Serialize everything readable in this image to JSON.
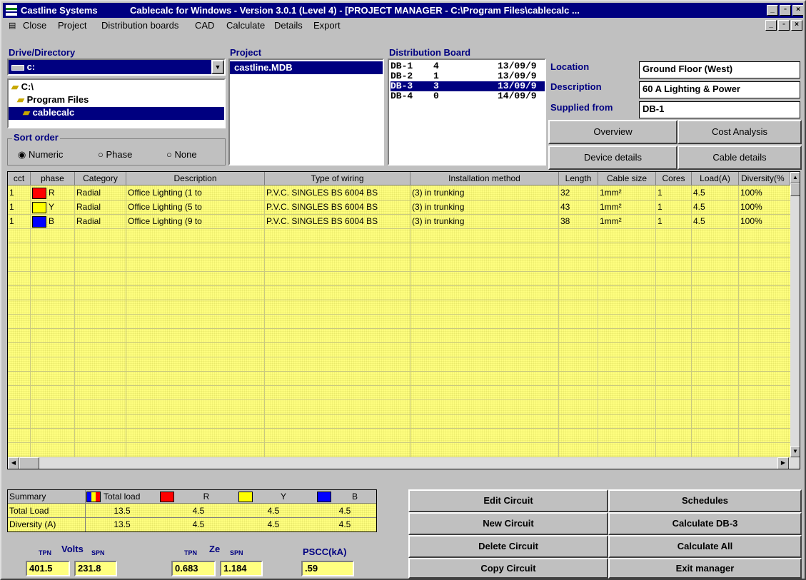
{
  "window": {
    "app_name": "Castline Systems",
    "title": "Cablecalc for Windows - Version 3.0.1   (Level  4) - [PROJECT MANAGER - C:\\Program Files\\cablecalc ..."
  },
  "menu": {
    "close": "Close",
    "project": "Project",
    "distribution_boards": "Distribution boards",
    "cad": "CAD",
    "calculate": "Calculate",
    "details": "Details",
    "export": "Export"
  },
  "drive": {
    "label": "Drive/Directory",
    "value": "c:",
    "dirs": [
      "C:\\",
      "Program Files",
      "cablecalc"
    ]
  },
  "sort": {
    "label": "Sort order",
    "options": [
      "Numeric",
      "Phase",
      "None"
    ],
    "selected": "Numeric"
  },
  "project": {
    "label": "Project",
    "items": [
      "castline.MDB"
    ]
  },
  "boards": {
    "label": "Distribution Board",
    "items": [
      {
        "name": "DB-1",
        "count": "4",
        "date": "13/09/9"
      },
      {
        "name": "DB-2",
        "count": "1",
        "date": "13/09/9"
      },
      {
        "name": "DB-3",
        "count": "3",
        "date": "13/09/9"
      },
      {
        "name": "DB-4",
        "count": "0",
        "date": "14/09/9"
      }
    ],
    "selected": "DB-3"
  },
  "info": {
    "location_label": "Location",
    "location": "Ground Floor (West)",
    "description_label": "Description",
    "description": "60 A Lighting & Power",
    "supplied_label": "Supplied from",
    "supplied": "DB-1"
  },
  "tabs": {
    "overview": "Overview",
    "cost_analysis": "Cost Analysis",
    "device_details": "Device details",
    "cable_details": "Cable details"
  },
  "grid": {
    "headers": [
      "cct",
      "phase",
      "Category",
      "Description",
      "Type of wiring",
      "Installation method",
      "Length",
      "Cable size",
      "Cores",
      "Load(A)",
      "Diversity(%"
    ],
    "rows": [
      {
        "cct": "1",
        "phase": "R",
        "color": "#ff0000",
        "category": "Radial",
        "description": "Office Lighting (1 to",
        "wiring": "P.V.C. SINGLES BS 6004 BS",
        "method": "(3) in trunking",
        "length": "32",
        "size": "1mm²",
        "cores": "1",
        "load": "4.5",
        "diversity": "100%"
      },
      {
        "cct": "1",
        "phase": "Y",
        "color": "#ffff00",
        "category": "Radial",
        "description": "Office Lighting (5 to",
        "wiring": "P.V.C. SINGLES BS 6004 BS",
        "method": "(3) in trunking",
        "length": "43",
        "size": "1mm²",
        "cores": "1",
        "load": "4.5",
        "diversity": "100%"
      },
      {
        "cct": "1",
        "phase": "B",
        "color": "#0000ff",
        "category": "Radial",
        "description": "Office Lighting (9 to",
        "wiring": "P.V.C. SINGLES BS 6004 BS",
        "method": "(3) in trunking",
        "length": "38",
        "size": "1mm²",
        "cores": "1",
        "load": "4.5",
        "diversity": "100%"
      }
    ]
  },
  "summary": {
    "title": "Summary",
    "total_load_hdr": "Total load",
    "r": "R",
    "y": "Y",
    "b": "B",
    "rows": [
      {
        "label": "Total Load",
        "total": "13.5",
        "r": "4.5",
        "y": "4.5",
        "b": "4.5"
      },
      {
        "label": "Diversity (A)",
        "total": "13.5",
        "r": "4.5",
        "y": "4.5",
        "b": "4.5"
      }
    ]
  },
  "readouts": {
    "tpn": "TPN",
    "spn": "SPN",
    "volts": "Volts",
    "ze": "Ze",
    "pscc": "PSCC(kA)",
    "volts_tpn": "401.5",
    "volts_spn": "231.8",
    "ze_tpn": "0.683",
    "ze_spn": "1.184",
    "pscc_val": ".59"
  },
  "actions": {
    "edit": "Edit Circuit",
    "new": "New Circuit",
    "delete": "Delete Circuit",
    "copy": "Copy Circuit",
    "schedules": "Schedules",
    "calc_db": "Calculate DB-3",
    "calc_all": "Calculate All",
    "exit": "Exit manager"
  }
}
